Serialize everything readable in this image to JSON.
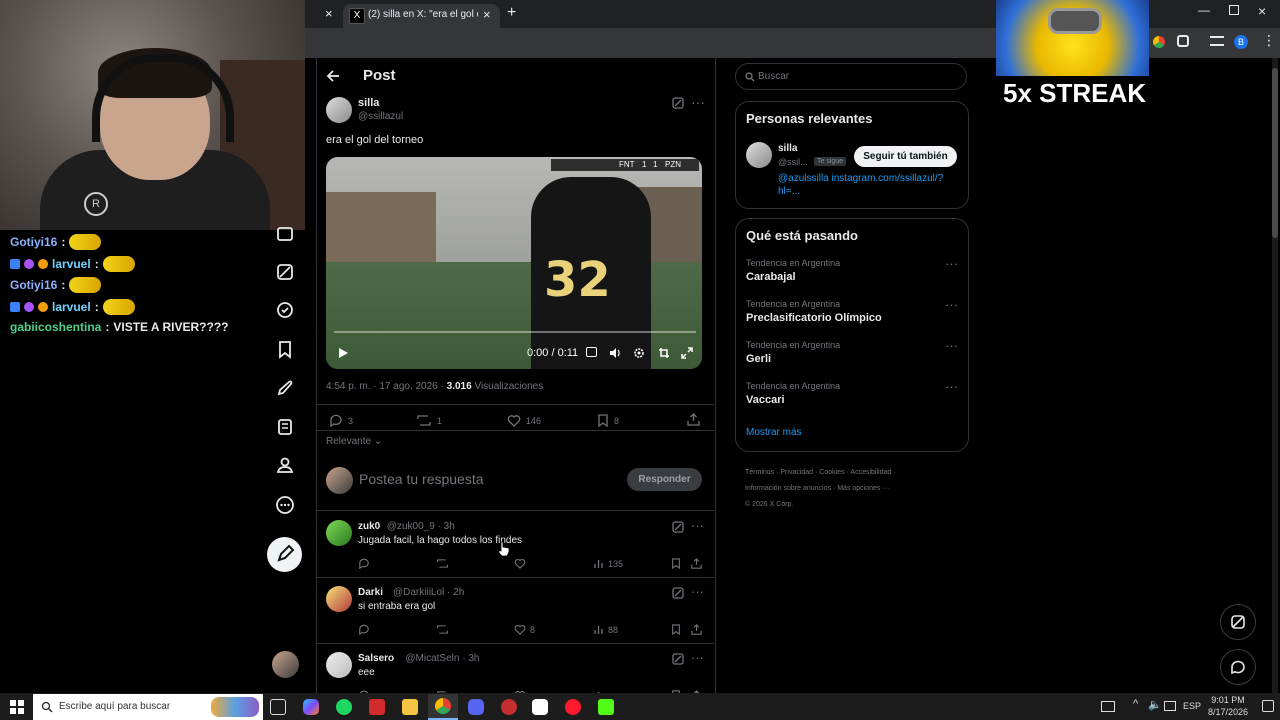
{
  "overlay": {
    "streak_text": "5x STREAK"
  },
  "chat": {
    "messages": [
      {
        "user": "Gotiyi16",
        "sep": " :",
        "text": "",
        "color": "#8fb0ff",
        "badges": false,
        "emote": true
      },
      {
        "user": "larvuel",
        "sep": " :",
        "text": "",
        "color": "#6fd3ff",
        "badges": true,
        "emote": true
      },
      {
        "user": "Gotiyi16",
        "sep": " :",
        "text": "",
        "color": "#8fb0ff",
        "badges": false,
        "emote": true
      },
      {
        "user": "larvuel",
        "sep": " :",
        "text": "",
        "color": "#6fd3ff",
        "badges": true,
        "emote": true
      },
      {
        "user": "gabiicoshentina",
        "sep": " :",
        "text": "VISTE A RIVER????",
        "color": "#4fd18b",
        "badges": false,
        "emote": false
      }
    ]
  },
  "browser": {
    "tab_title": "(2) silla en X: \"era el gol del",
    "tab_close": "×",
    "new_tab": "+"
  },
  "post": {
    "header_title": "Post",
    "author_name": "silla",
    "author_handle": "@ssillazul",
    "text": "era el gol del torneo",
    "video": {
      "time": "0:00 / 0:11",
      "scoreboard_team1": "FNT",
      "scoreboard_score1": "1",
      "scoreboard_score2": "1",
      "scoreboard_team2": "PZN",
      "jersey_number": "32"
    },
    "meta_time": "4:54 p. m. · 17 ago. 2026 · ",
    "meta_views_count": "3.016",
    "meta_views_label": " Visualizaciones",
    "actions": {
      "replies": "3",
      "reposts": "1",
      "likes": "146",
      "bookmarks": "8"
    },
    "sort_label": "Relevante",
    "reply_placeholder": "Postea tu respuesta",
    "reply_button": "Responder"
  },
  "replies": [
    {
      "name": "zuk0",
      "handle": "@zuk00_9 · 3h",
      "text": "Jugada facil, la hago todos los findes",
      "likes": "",
      "views": "135"
    },
    {
      "name": "Darki",
      "handle": "@DarkiiiLol · 2h",
      "text": "si entraba era gol",
      "likes": "8",
      "views": "88"
    },
    {
      "name": "Salsero",
      "handle": "@MicatSeln · 3h",
      "text": "eee",
      "likes": "",
      "views": ""
    }
  ],
  "sidebar": {
    "search_placeholder": "Buscar",
    "relevant_title": "Personas relevantes",
    "relevant_user_name": "silla",
    "relevant_user_handle": "@ssil...",
    "follows_you": "Te sigue",
    "follow_button": "Seguir tú también",
    "relevant_bio": "@azulssilla instagram.com/ssillazul/?hl=...",
    "trends_title": "Qué está pasando",
    "trends": [
      {
        "context": "Tendencia en Argentina",
        "name": "Carabajal"
      },
      {
        "context": "Tendencia en Argentina",
        "name": "Preclasificatorio Olímpico"
      },
      {
        "context": "Tendencia en Argentina",
        "name": "Gerli"
      },
      {
        "context": "Tendencia en Argentina",
        "name": "Vaccari"
      }
    ],
    "show_more": "Mostrar más",
    "footer_line1": "Términos · Privacidad · Cookies · Accesibilidad ·",
    "footer_line2": "Información sobre anuncios · Más opciones ···",
    "footer_line3": "© 2026 X Corp."
  },
  "taskbar": {
    "search_placeholder": "Escribe aquí para buscar",
    "lang": "ESP",
    "time": "9:01 PM",
    "date": "8/17/2026"
  }
}
